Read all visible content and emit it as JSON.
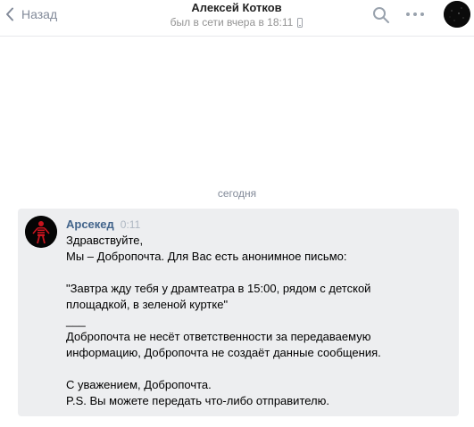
{
  "header": {
    "back_label": "Назад",
    "title": "Алексей Котков",
    "status": "был в сети вчера в 18:11",
    "icons": {
      "back": "chevron-left-icon",
      "search": "search-icon",
      "more": "more-icon",
      "status_device": "phone-icon"
    }
  },
  "date_separator": "сегодня",
  "message": {
    "author": "Арсекед",
    "time": "0:11",
    "lines": [
      "Здравствуйте,",
      "Мы – Добропочта. Для Вас есть анонимное письмо:",
      "",
      "\"Завтра жду тебя у драмтеатра в 15:00, рядом с детской",
      "площадкой, в зеленой куртке\"",
      "___",
      "Добропочта не несёт ответственности за передаваемую",
      "информацию, Добропочта не создаёт данные сообщения.",
      "",
      "С уважением, Добропочта.",
      "P.S. Вы можете передать что-либо отправителю."
    ]
  },
  "colors": {
    "link": "#42648b",
    "muted": "#828a99",
    "message_background": "#edeef0",
    "avatar_accent": "#c8141e"
  }
}
